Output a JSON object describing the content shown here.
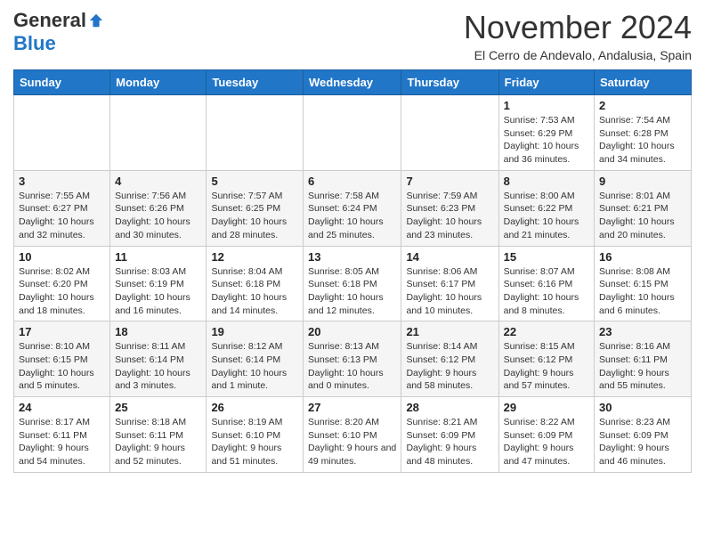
{
  "header": {
    "logo_general": "General",
    "logo_blue": "Blue",
    "month_title": "November 2024",
    "location": "El Cerro de Andevalo, Andalusia, Spain"
  },
  "columns": [
    "Sunday",
    "Monday",
    "Tuesday",
    "Wednesday",
    "Thursday",
    "Friday",
    "Saturday"
  ],
  "weeks": [
    [
      {
        "day": "",
        "info": ""
      },
      {
        "day": "",
        "info": ""
      },
      {
        "day": "",
        "info": ""
      },
      {
        "day": "",
        "info": ""
      },
      {
        "day": "",
        "info": ""
      },
      {
        "day": "1",
        "info": "Sunrise: 7:53 AM\nSunset: 6:29 PM\nDaylight: 10 hours and 36 minutes."
      },
      {
        "day": "2",
        "info": "Sunrise: 7:54 AM\nSunset: 6:28 PM\nDaylight: 10 hours and 34 minutes."
      }
    ],
    [
      {
        "day": "3",
        "info": "Sunrise: 7:55 AM\nSunset: 6:27 PM\nDaylight: 10 hours and 32 minutes."
      },
      {
        "day": "4",
        "info": "Sunrise: 7:56 AM\nSunset: 6:26 PM\nDaylight: 10 hours and 30 minutes."
      },
      {
        "day": "5",
        "info": "Sunrise: 7:57 AM\nSunset: 6:25 PM\nDaylight: 10 hours and 28 minutes."
      },
      {
        "day": "6",
        "info": "Sunrise: 7:58 AM\nSunset: 6:24 PM\nDaylight: 10 hours and 25 minutes."
      },
      {
        "day": "7",
        "info": "Sunrise: 7:59 AM\nSunset: 6:23 PM\nDaylight: 10 hours and 23 minutes."
      },
      {
        "day": "8",
        "info": "Sunrise: 8:00 AM\nSunset: 6:22 PM\nDaylight: 10 hours and 21 minutes."
      },
      {
        "day": "9",
        "info": "Sunrise: 8:01 AM\nSunset: 6:21 PM\nDaylight: 10 hours and 20 minutes."
      }
    ],
    [
      {
        "day": "10",
        "info": "Sunrise: 8:02 AM\nSunset: 6:20 PM\nDaylight: 10 hours and 18 minutes."
      },
      {
        "day": "11",
        "info": "Sunrise: 8:03 AM\nSunset: 6:19 PM\nDaylight: 10 hours and 16 minutes."
      },
      {
        "day": "12",
        "info": "Sunrise: 8:04 AM\nSunset: 6:18 PM\nDaylight: 10 hours and 14 minutes."
      },
      {
        "day": "13",
        "info": "Sunrise: 8:05 AM\nSunset: 6:18 PM\nDaylight: 10 hours and 12 minutes."
      },
      {
        "day": "14",
        "info": "Sunrise: 8:06 AM\nSunset: 6:17 PM\nDaylight: 10 hours and 10 minutes."
      },
      {
        "day": "15",
        "info": "Sunrise: 8:07 AM\nSunset: 6:16 PM\nDaylight: 10 hours and 8 minutes."
      },
      {
        "day": "16",
        "info": "Sunrise: 8:08 AM\nSunset: 6:15 PM\nDaylight: 10 hours and 6 minutes."
      }
    ],
    [
      {
        "day": "17",
        "info": "Sunrise: 8:10 AM\nSunset: 6:15 PM\nDaylight: 10 hours and 5 minutes."
      },
      {
        "day": "18",
        "info": "Sunrise: 8:11 AM\nSunset: 6:14 PM\nDaylight: 10 hours and 3 minutes."
      },
      {
        "day": "19",
        "info": "Sunrise: 8:12 AM\nSunset: 6:14 PM\nDaylight: 10 hours and 1 minute."
      },
      {
        "day": "20",
        "info": "Sunrise: 8:13 AM\nSunset: 6:13 PM\nDaylight: 10 hours and 0 minutes."
      },
      {
        "day": "21",
        "info": "Sunrise: 8:14 AM\nSunset: 6:12 PM\nDaylight: 9 hours and 58 minutes."
      },
      {
        "day": "22",
        "info": "Sunrise: 8:15 AM\nSunset: 6:12 PM\nDaylight: 9 hours and 57 minutes."
      },
      {
        "day": "23",
        "info": "Sunrise: 8:16 AM\nSunset: 6:11 PM\nDaylight: 9 hours and 55 minutes."
      }
    ],
    [
      {
        "day": "24",
        "info": "Sunrise: 8:17 AM\nSunset: 6:11 PM\nDaylight: 9 hours and 54 minutes."
      },
      {
        "day": "25",
        "info": "Sunrise: 8:18 AM\nSunset: 6:11 PM\nDaylight: 9 hours and 52 minutes."
      },
      {
        "day": "26",
        "info": "Sunrise: 8:19 AM\nSunset: 6:10 PM\nDaylight: 9 hours and 51 minutes."
      },
      {
        "day": "27",
        "info": "Sunrise: 8:20 AM\nSunset: 6:10 PM\nDaylight: 9 hours and 49 minutes."
      },
      {
        "day": "28",
        "info": "Sunrise: 8:21 AM\nSunset: 6:09 PM\nDaylight: 9 hours and 48 minutes."
      },
      {
        "day": "29",
        "info": "Sunrise: 8:22 AM\nSunset: 6:09 PM\nDaylight: 9 hours and 47 minutes."
      },
      {
        "day": "30",
        "info": "Sunrise: 8:23 AM\nSunset: 6:09 PM\nDaylight: 9 hours and 46 minutes."
      }
    ]
  ]
}
